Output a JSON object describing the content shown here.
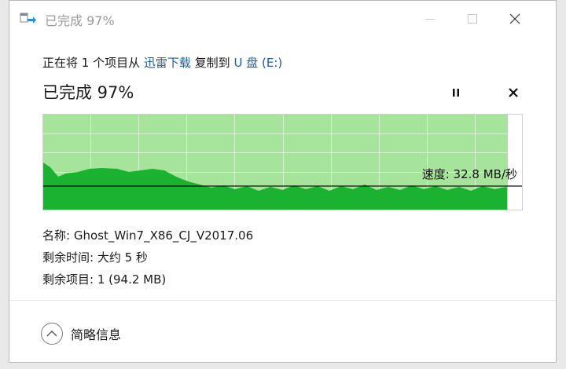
{
  "window": {
    "title": "已完成 97%"
  },
  "copy": {
    "prefix": "正在将 1 个项目从",
    "source": "迅雷下载",
    "middle": "复制到",
    "destination": "U 盘 (E:)"
  },
  "progress": {
    "label": "已完成 97%",
    "percent": 97
  },
  "speed": {
    "label": "速度: 32.8 MB/秒"
  },
  "details": {
    "name_label": "名称:",
    "name_value": "Ghost_Win7_X86_CJ_V2017.06",
    "time_label": "剩余时间:",
    "time_value": "大约 5 秒",
    "items_label": "剩余项目:",
    "items_value": "1 (94.2 MB)"
  },
  "footer": {
    "less_details_label": "简略信息"
  },
  "colors": {
    "progress_fill": "#a6e39b",
    "throughput_fill": "#1bb232",
    "chart_border": "#cfcfcf",
    "link": "#1a5ea5"
  },
  "icons": {
    "title": "copy-file-icon",
    "minimize": "minimize-icon",
    "maximize": "maximize-icon",
    "close": "close-icon",
    "pause": "pause-icon",
    "stop": "stop-icon",
    "collapse": "chevron-up-icon"
  }
}
